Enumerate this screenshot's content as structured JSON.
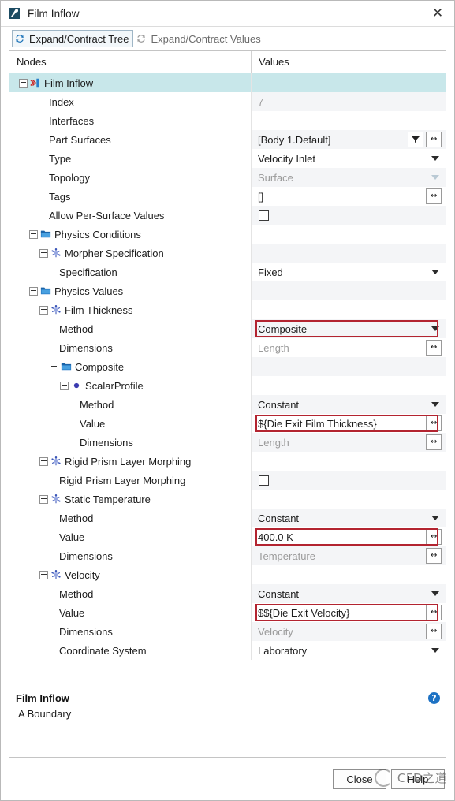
{
  "window": {
    "title": "Film Inflow",
    "title_icon": "node-properties-icon",
    "close_label": "✕"
  },
  "toolbar": {
    "buttons": [
      {
        "label": "Expand/Contract Tree",
        "icon": "refresh-icon",
        "state": "focused"
      },
      {
        "label": "Expand/Contract Values",
        "icon": "refresh-icon",
        "state": "disabled"
      }
    ]
  },
  "table": {
    "columns": [
      "Nodes",
      "Values"
    ],
    "rows": [
      {
        "label": "Film Inflow",
        "indent": 0,
        "expander": true,
        "icon": "boundary-icon",
        "selected": true,
        "value": "",
        "value_type": "empty"
      },
      {
        "label": "Index",
        "indent": 2,
        "expander": false,
        "icon": "none",
        "value": "7",
        "value_type": "readonly"
      },
      {
        "label": "Interfaces",
        "indent": 2,
        "expander": false,
        "icon": "none",
        "value": "",
        "value_type": "empty"
      },
      {
        "label": "Part Surfaces",
        "indent": 2,
        "expander": false,
        "icon": "none",
        "value": "[Body 1.Default]",
        "value_type": "filter-ellipsis"
      },
      {
        "label": "Type",
        "indent": 2,
        "expander": false,
        "icon": "none",
        "value": "Velocity Inlet",
        "value_type": "combo"
      },
      {
        "label": "Topology",
        "indent": 2,
        "expander": false,
        "icon": "none",
        "value": "Surface",
        "value_type": "combo-disabled"
      },
      {
        "label": "Tags",
        "indent": 2,
        "expander": false,
        "icon": "none",
        "value": "[]",
        "value_type": "ellipsis"
      },
      {
        "label": "Allow Per-Surface Values",
        "indent": 2,
        "expander": false,
        "icon": "none",
        "value": "",
        "value_type": "checkbox"
      },
      {
        "label": "Physics Conditions",
        "indent": 1,
        "expander": true,
        "icon": "folder-icon",
        "value": "",
        "value_type": "empty"
      },
      {
        "label": "Morpher Specification",
        "indent": 2,
        "expander": true,
        "icon": "node-icon",
        "value": "",
        "value_type": "empty"
      },
      {
        "label": "Specification",
        "indent": 3,
        "expander": false,
        "icon": "none",
        "value": "Fixed",
        "value_type": "combo"
      },
      {
        "label": "Physics Values",
        "indent": 1,
        "expander": true,
        "icon": "folder-icon",
        "value": "",
        "value_type": "empty"
      },
      {
        "label": "Film Thickness",
        "indent": 2,
        "expander": true,
        "icon": "node-icon",
        "value": "",
        "value_type": "empty"
      },
      {
        "label": "Method",
        "indent": 3,
        "expander": false,
        "icon": "none",
        "value": "Composite",
        "value_type": "combo",
        "highlight": true
      },
      {
        "label": "Dimensions",
        "indent": 3,
        "expander": false,
        "icon": "none",
        "value": "Length",
        "value_type": "ellipsis-dim"
      },
      {
        "label": "Composite",
        "indent": 3,
        "expander": true,
        "icon": "folder-icon",
        "value": "",
        "value_type": "empty"
      },
      {
        "label": "ScalarProfile",
        "indent": 4,
        "expander": true,
        "icon": "dot-icon",
        "value": "",
        "value_type": "empty"
      },
      {
        "label": "Method",
        "indent": 5,
        "expander": false,
        "icon": "none",
        "value": "Constant",
        "value_type": "combo"
      },
      {
        "label": "Value",
        "indent": 5,
        "expander": false,
        "icon": "none",
        "value": "${Die Exit Film Thickness}",
        "value_type": "ellipsis",
        "highlight": true
      },
      {
        "label": "Dimensions",
        "indent": 5,
        "expander": false,
        "icon": "none",
        "value": "Length",
        "value_type": "ellipsis-dim"
      },
      {
        "label": "Rigid Prism Layer Morphing",
        "indent": 2,
        "expander": true,
        "icon": "node-icon",
        "value": "",
        "value_type": "empty"
      },
      {
        "label": "Rigid Prism Layer Morphing",
        "indent": 3,
        "expander": false,
        "icon": "none",
        "value": "",
        "value_type": "checkbox"
      },
      {
        "label": "Static Temperature",
        "indent": 2,
        "expander": true,
        "icon": "node-icon",
        "value": "",
        "value_type": "empty"
      },
      {
        "label": "Method",
        "indent": 3,
        "expander": false,
        "icon": "none",
        "value": "Constant",
        "value_type": "combo"
      },
      {
        "label": "Value",
        "indent": 3,
        "expander": false,
        "icon": "none",
        "value": "400.0 K",
        "value_type": "ellipsis",
        "highlight": true
      },
      {
        "label": "Dimensions",
        "indent": 3,
        "expander": false,
        "icon": "none",
        "value": "Temperature",
        "value_type": "ellipsis-dim"
      },
      {
        "label": "Velocity",
        "indent": 2,
        "expander": true,
        "icon": "node-icon",
        "value": "",
        "value_type": "empty"
      },
      {
        "label": "Method",
        "indent": 3,
        "expander": false,
        "icon": "none",
        "value": "Constant",
        "value_type": "combo"
      },
      {
        "label": "Value",
        "indent": 3,
        "expander": false,
        "icon": "none",
        "value": "$${Die Exit Velocity}",
        "value_type": "ellipsis",
        "highlight": true
      },
      {
        "label": "Dimensions",
        "indent": 3,
        "expander": false,
        "icon": "none",
        "value": "Velocity",
        "value_type": "ellipsis-dim"
      },
      {
        "label": "Coordinate System",
        "indent": 3,
        "expander": false,
        "icon": "none",
        "value": "Laboratory",
        "value_type": "combo"
      }
    ]
  },
  "description": {
    "title": "Film Inflow",
    "subtitle": "A Boundary",
    "help_icon": "help-icon",
    "help_glyph": "?"
  },
  "footer": {
    "buttons": [
      {
        "label": "Close",
        "name": "close-button"
      },
      {
        "label": "Help",
        "name": "help-button"
      }
    ]
  },
  "watermark": {
    "text": "CFD之道"
  },
  "colors": {
    "selection": "#c8e7ea",
    "highlight": "#b32430",
    "alt_row": "#f4f5f7",
    "folder": "#2a7fc9",
    "help_blue": "#1d72c4"
  }
}
